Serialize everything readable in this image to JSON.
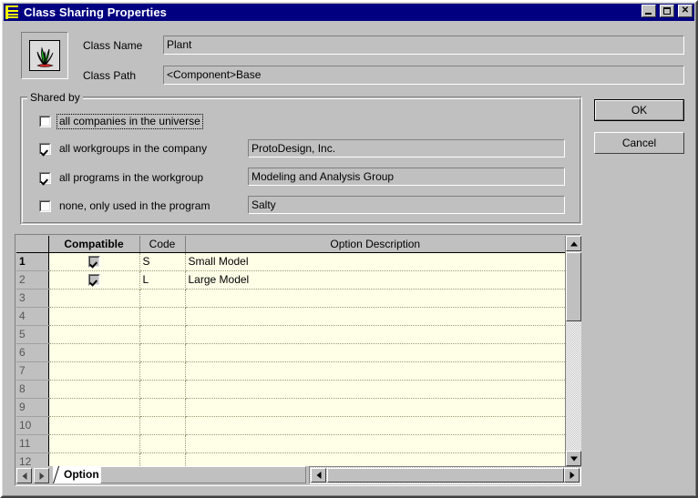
{
  "window": {
    "title": "Class Sharing Properties",
    "icon": "stacked-bars-icon",
    "minimize_label": "",
    "maximize_label": "",
    "close_label": "✕"
  },
  "class_info": {
    "icon": "plant-grass-icon",
    "name_label": "Class Name",
    "name_value": "Plant",
    "path_label": "Class Path",
    "path_value": "<Component>Base"
  },
  "shared_by": {
    "group_title": "Shared by",
    "options": [
      {
        "label": "all companies in the universe",
        "checked": false,
        "focused": true,
        "value": null
      },
      {
        "label": "all workgroups in the company",
        "checked": true,
        "focused": false,
        "value": "ProtoDesign, Inc."
      },
      {
        "label": "all programs in the workgroup",
        "checked": true,
        "focused": false,
        "value": "Modeling and Analysis Group"
      },
      {
        "label": "none, only used in the program",
        "checked": false,
        "focused": false,
        "value": "Salty"
      }
    ]
  },
  "buttons": {
    "ok": "OK",
    "cancel": "Cancel"
  },
  "grid": {
    "columns": [
      "",
      "Compatible",
      "Code",
      "Option Description"
    ],
    "rows": [
      {
        "num": "1",
        "compatible": true,
        "code": "S",
        "description": "Small Model",
        "current": true
      },
      {
        "num": "2",
        "compatible": true,
        "code": "L",
        "description": "Large Model",
        "current": false
      },
      {
        "num": "3",
        "compatible": null,
        "code": "",
        "description": "",
        "current": false
      },
      {
        "num": "4",
        "compatible": null,
        "code": "",
        "description": "",
        "current": false
      },
      {
        "num": "5",
        "compatible": null,
        "code": "",
        "description": "",
        "current": false
      },
      {
        "num": "6",
        "compatible": null,
        "code": "",
        "description": "",
        "current": false
      },
      {
        "num": "7",
        "compatible": null,
        "code": "",
        "description": "",
        "current": false
      },
      {
        "num": "8",
        "compatible": null,
        "code": "",
        "description": "",
        "current": false
      },
      {
        "num": "9",
        "compatible": null,
        "code": "",
        "description": "",
        "current": false
      },
      {
        "num": "10",
        "compatible": null,
        "code": "",
        "description": "",
        "current": false
      },
      {
        "num": "11",
        "compatible": null,
        "code": "",
        "description": "",
        "current": false
      },
      {
        "num": "12",
        "compatible": null,
        "code": "",
        "description": "",
        "current": false
      }
    ]
  },
  "tabs": {
    "prev_icon": "triangle-left-icon",
    "next_icon": "triangle-right-icon",
    "active": "Option",
    "items": [
      "Option"
    ]
  },
  "scrollbars": {
    "vertical": {
      "up_icon": "triangle-up-icon",
      "down_icon": "triangle-down-icon"
    },
    "horizontal": {
      "left_icon": "triangle-left-icon",
      "right_icon": "triangle-right-icon"
    }
  },
  "colors": {
    "titlebar": "#000080",
    "face": "#c0c0c0",
    "grid_background": "#ffffe8",
    "accent_icon": "#00cc00"
  }
}
